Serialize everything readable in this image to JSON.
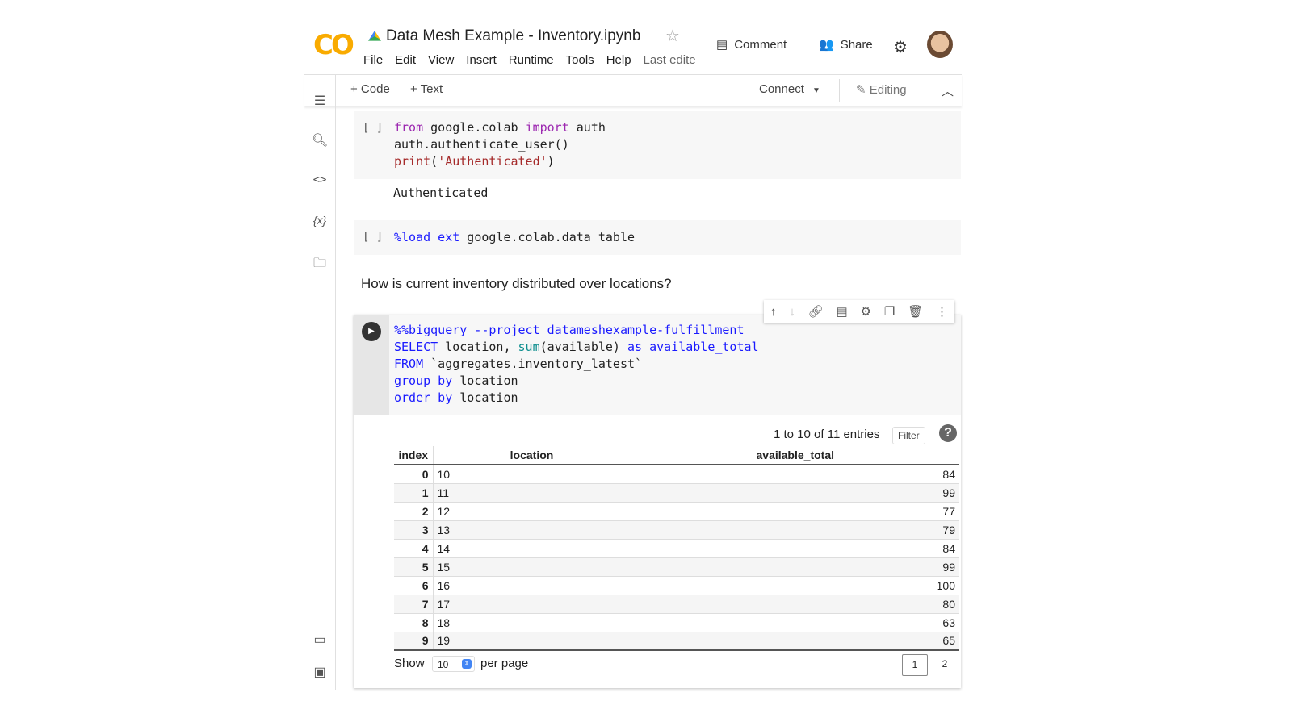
{
  "header": {
    "logo": "CO",
    "title": "Data Mesh Example - Inventory.ipynb",
    "menu": [
      "File",
      "Edit",
      "View",
      "Insert",
      "Runtime",
      "Tools",
      "Help"
    ],
    "last_edited": "Last edited",
    "comment": "Comment",
    "share": "Share"
  },
  "toolbar": {
    "add_code": "+ Code",
    "add_text": "+ Text",
    "connect": "Connect",
    "editing": "Editing"
  },
  "cells": {
    "c1_bracket": "[ ]",
    "c1_output": "Authenticated",
    "c2_bracket": "[ ]",
    "text": "How is current inventory distributed over locations?"
  },
  "table": {
    "summary": "1 to 10 of 11 entries",
    "filter": "Filter",
    "help": "?",
    "columns": [
      "index",
      "location",
      "available_total"
    ],
    "rows": [
      [
        "0",
        "10",
        "84"
      ],
      [
        "1",
        "11",
        "99"
      ],
      [
        "2",
        "12",
        "77"
      ],
      [
        "3",
        "13",
        "79"
      ],
      [
        "4",
        "14",
        "84"
      ],
      [
        "5",
        "15",
        "99"
      ],
      [
        "6",
        "16",
        "100"
      ],
      [
        "7",
        "17",
        "80"
      ],
      [
        "8",
        "18",
        "63"
      ],
      [
        "9",
        "19",
        "65"
      ]
    ],
    "show": "Show",
    "per_page_value": "10",
    "per_page": "per page",
    "pages": [
      "1",
      "2"
    ]
  }
}
